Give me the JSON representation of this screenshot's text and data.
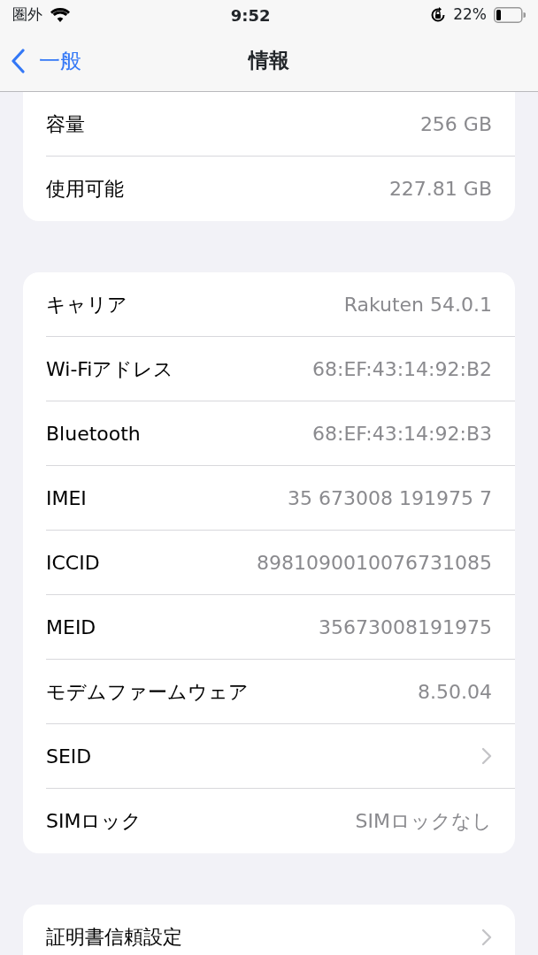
{
  "status_bar": {
    "carrier": "圏外",
    "time": "9:52",
    "battery": "22%"
  },
  "nav": {
    "back": "一般",
    "title": "情報"
  },
  "groups": [
    {
      "cut_top": true,
      "rows": [
        {
          "kind": "value",
          "label": "容量",
          "value": "256 GB"
        },
        {
          "kind": "value",
          "label": "使用可能",
          "value": "227.81 GB"
        }
      ]
    },
    {
      "cut_top": false,
      "rows": [
        {
          "kind": "value",
          "label": "キャリア",
          "value": "Rakuten 54.0.1"
        },
        {
          "kind": "value",
          "label": "Wi-Fiアドレス",
          "value": "68:EF:43:14:92:B2"
        },
        {
          "kind": "value",
          "label": "Bluetooth",
          "value": "68:EF:43:14:92:B3"
        },
        {
          "kind": "value",
          "label": "IMEI",
          "value": "35 673008 191975 7"
        },
        {
          "kind": "value",
          "label": "ICCID",
          "value": "8981090010076731085"
        },
        {
          "kind": "value",
          "label": "MEID",
          "value": "35673008191975"
        },
        {
          "kind": "value",
          "label": "モデムファームウェア",
          "value": "8.50.04"
        },
        {
          "kind": "link",
          "label": "SEID"
        },
        {
          "kind": "value",
          "label": "SIMロック",
          "value": "SIMロックなし"
        }
      ]
    },
    {
      "cut_top": false,
      "rows": [
        {
          "kind": "link",
          "label": "証明書信頼設定"
        }
      ]
    }
  ]
}
